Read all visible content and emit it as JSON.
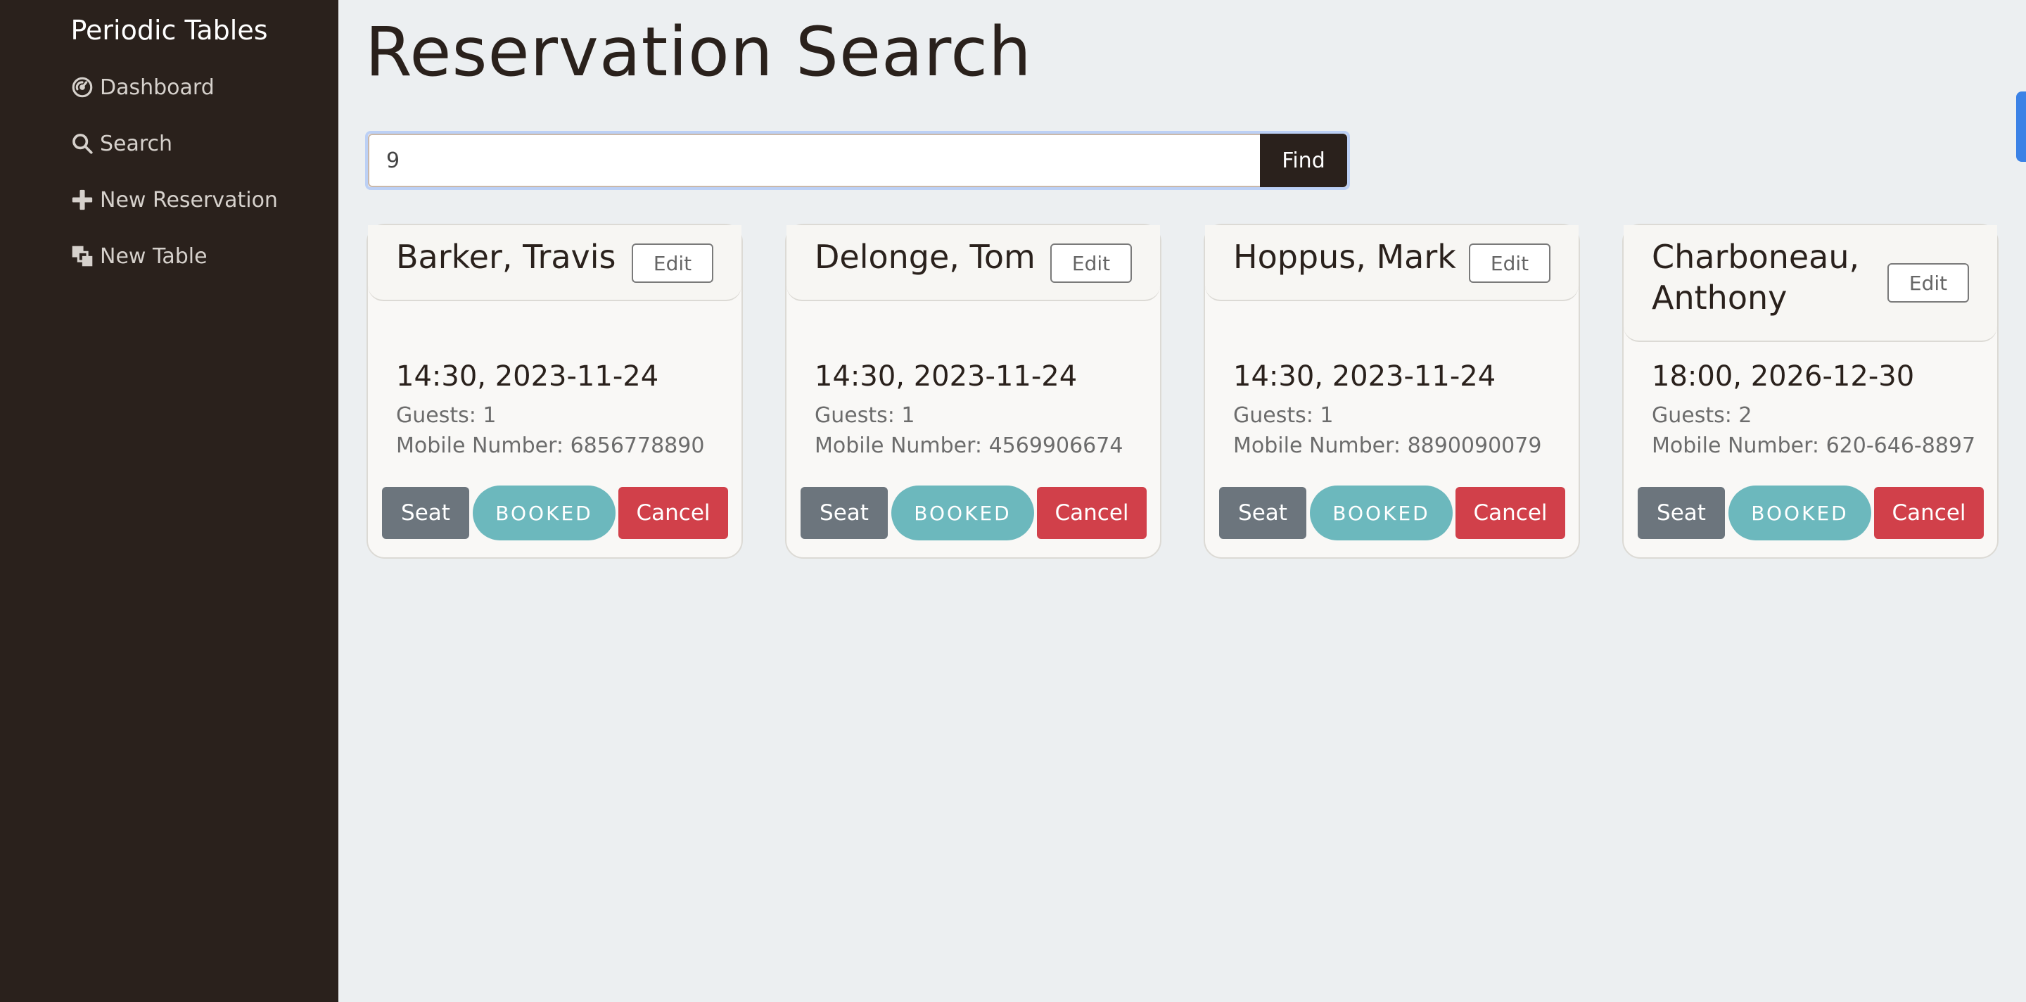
{
  "sidebar": {
    "brand": "Periodic Tables",
    "items": [
      {
        "label": "Dashboard",
        "icon": "dashboard-icon"
      },
      {
        "label": "Search",
        "icon": "search-icon"
      },
      {
        "label": "New Reservation",
        "icon": "plus-icon"
      },
      {
        "label": "New Table",
        "icon": "layers-icon"
      }
    ]
  },
  "main": {
    "title": "Reservation Search",
    "search": {
      "value": "9",
      "button_label": "Find"
    },
    "reservations": [
      {
        "name": "Barker, Travis",
        "edit_label": "Edit",
        "datetime": "14:30, 2023-11-24",
        "guests": "Guests: 1",
        "mobile": "Mobile Number: 6856778890",
        "seat_label": "Seat",
        "status": "BOOKED",
        "cancel_label": "Cancel"
      },
      {
        "name": "Delonge, Tom",
        "edit_label": "Edit",
        "datetime": "14:30, 2023-11-24",
        "guests": "Guests: 1",
        "mobile": "Mobile Number: 4569906674",
        "seat_label": "Seat",
        "status": "BOOKED",
        "cancel_label": "Cancel"
      },
      {
        "name": "Hoppus, Mark",
        "edit_label": "Edit",
        "datetime": "14:30, 2023-11-24",
        "guests": "Guests: 1",
        "mobile": "Mobile Number: 8890090079",
        "seat_label": "Seat",
        "status": "BOOKED",
        "cancel_label": "Cancel"
      },
      {
        "name": "Charboneau, Anthony",
        "edit_label": "Edit",
        "datetime": "18:00, 2026-12-30",
        "guests": "Guests: 2",
        "mobile": "Mobile Number: 620-646-8897",
        "seat_label": "Seat",
        "status": "BOOKED",
        "cancel_label": "Cancel"
      }
    ]
  },
  "colors": {
    "sidebar_bg": "#2a211c",
    "page_bg": "#eceff1",
    "seat": "#6c757d",
    "booked": "#6cb8bd",
    "cancel": "#d1404a"
  }
}
